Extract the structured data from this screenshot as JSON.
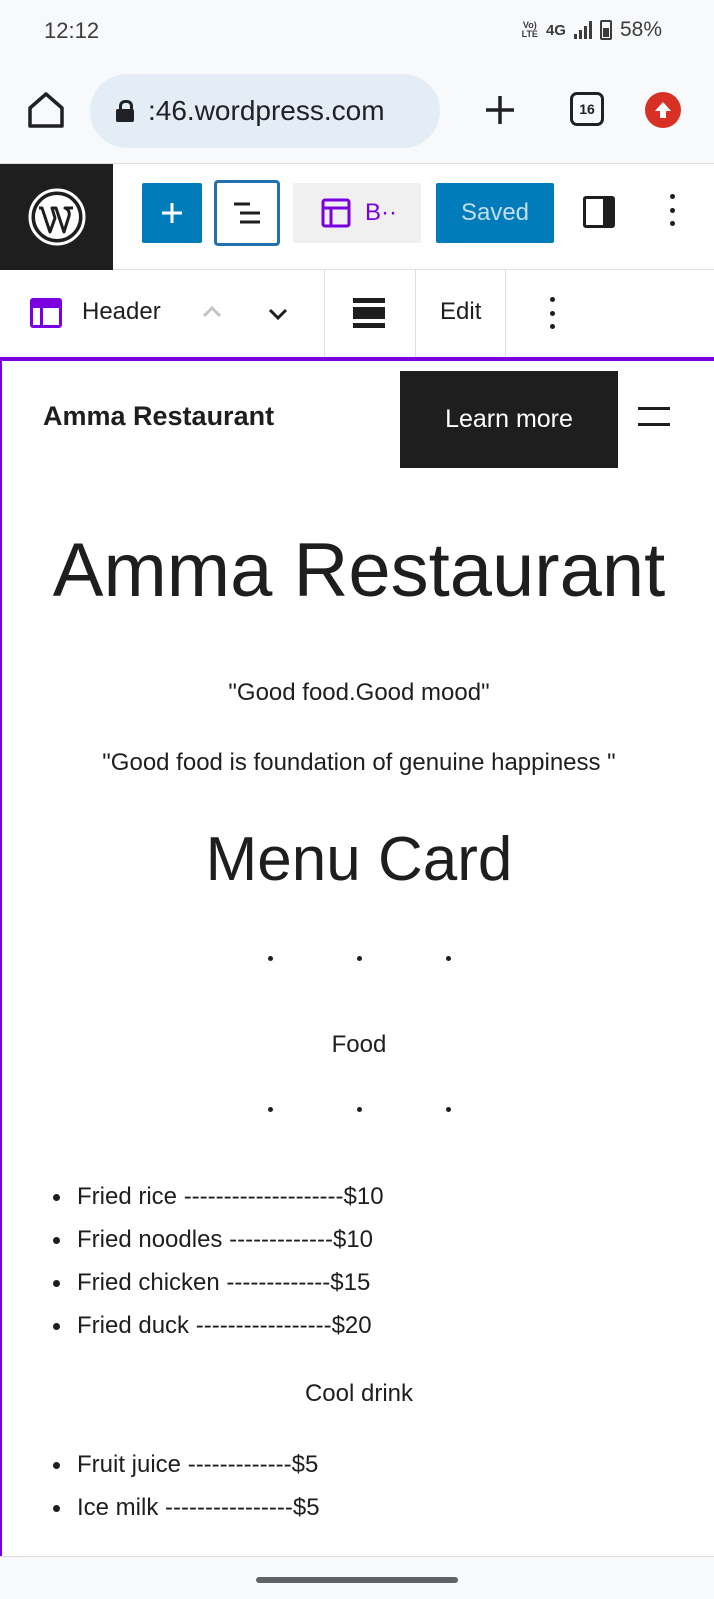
{
  "status_bar": {
    "time": "12:12",
    "volte": "Vo) LTE",
    "network": "4G",
    "battery": "58%"
  },
  "browser": {
    "url": ":46.wordpress.com",
    "tab_count": "16"
  },
  "editor_toolbar": {
    "template_label": "B··",
    "saved_label": "Saved"
  },
  "block_toolbar": {
    "block_label": "Header",
    "edit_label": "Edit"
  },
  "site_header": {
    "title": "Amma Restaurant",
    "button_label": "Learn more"
  },
  "content": {
    "hero_title": "Amma Restaurant",
    "tagline_1": "\"Good food.Good mood\"",
    "tagline_2": "\"Good food is foundation of genuine happiness \"",
    "menu_title": "Menu Card",
    "food_label": "Food",
    "food_items": [
      "Fried rice --------------------$10",
      "Fried noodles -------------$10",
      "Fried chicken -------------$15",
      "Fried duck -----------------$20"
    ],
    "drink_label": "Cool drink",
    "drink_items": [
      "Fruit juice -------------$5",
      "Ice milk ----------------$5"
    ]
  },
  "colors": {
    "accent": "#7a00df",
    "primary_button": "#007cba",
    "dark": "#1e1e1e",
    "update_badge": "#d93025"
  }
}
